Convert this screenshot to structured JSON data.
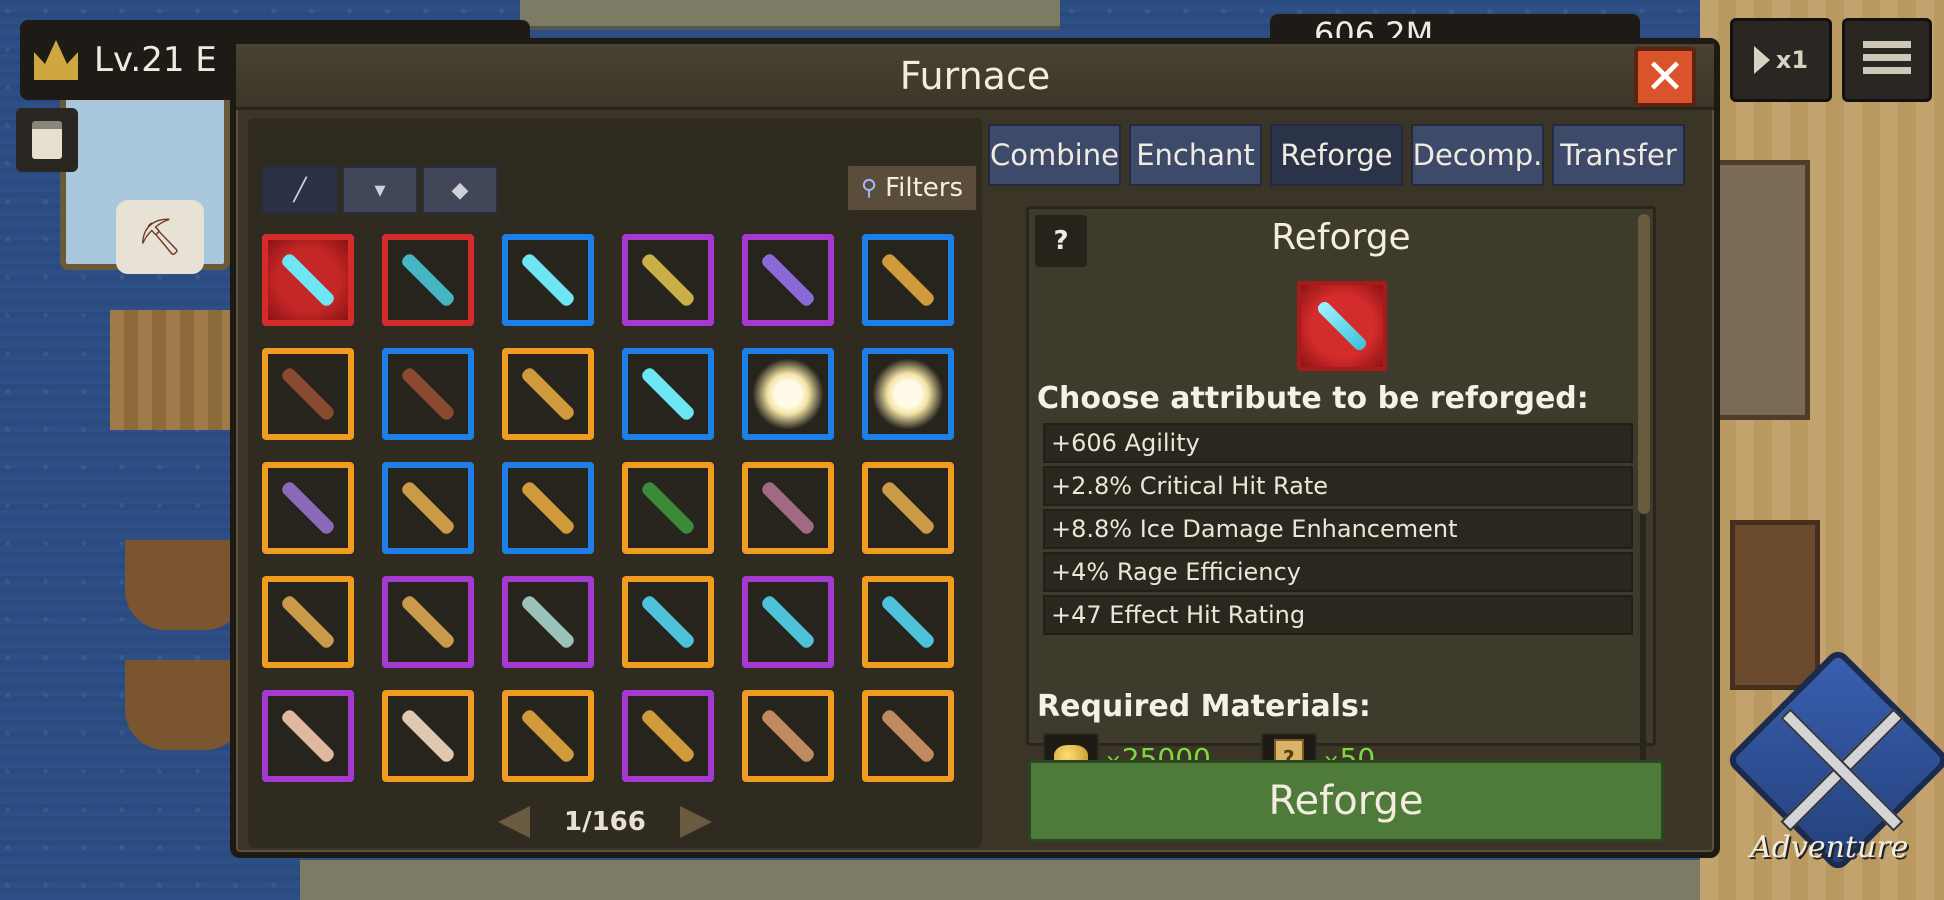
{
  "hud": {
    "level": "Lv.21 E",
    "currency": "606.2M",
    "speed": "x1"
  },
  "adventure": {
    "label": "Adventure"
  },
  "dialog": {
    "title": "Furnace",
    "close": "✕"
  },
  "left": {
    "filters_label": "Filters",
    "page": "1/166",
    "items": [
      {
        "frame": "red",
        "glow": true,
        "weapon": "#6ee5f2"
      },
      {
        "frame": "red",
        "glow": false,
        "weapon": "#46b6c4"
      },
      {
        "frame": "blue",
        "glow": false,
        "weapon": "#6ee5f2"
      },
      {
        "frame": "purple",
        "glow": false,
        "weapon": "#c8b046"
      },
      {
        "frame": "purple",
        "glow": false,
        "weapon": "#8a6ad8"
      },
      {
        "frame": "blue",
        "glow": false,
        "weapon": "#d09a3a"
      },
      {
        "frame": "orange",
        "glow": false,
        "weapon": "#8a4a30"
      },
      {
        "frame": "blue",
        "glow": false,
        "weapon": "#8a4a30"
      },
      {
        "frame": "orange",
        "glow": false,
        "weapon": "#d09a3a"
      },
      {
        "frame": "blue",
        "glow": false,
        "weapon": "#6ee5f2"
      },
      {
        "frame": "blue",
        "glow": false,
        "weapon": "burst"
      },
      {
        "frame": "blue",
        "glow": false,
        "weapon": "burst"
      },
      {
        "frame": "orange",
        "glow": false,
        "weapon": "#8a6ab8"
      },
      {
        "frame": "blue",
        "glow": false,
        "weapon": "#c89a4a"
      },
      {
        "frame": "blue",
        "glow": false,
        "weapon": "#d09a3a"
      },
      {
        "frame": "orange",
        "glow": false,
        "weapon": "#3a8a3a"
      },
      {
        "frame": "orange",
        "glow": false,
        "weapon": "#a06a80"
      },
      {
        "frame": "orange",
        "glow": false,
        "weapon": "#c89a4a"
      },
      {
        "frame": "orange",
        "glow": false,
        "weapon": "#c89a4a"
      },
      {
        "frame": "purple",
        "glow": false,
        "weapon": "#c89a4a"
      },
      {
        "frame": "purple",
        "glow": false,
        "weapon": "#9ac2b8"
      },
      {
        "frame": "orange",
        "glow": false,
        "weapon": "#4ec2d8"
      },
      {
        "frame": "purple",
        "glow": false,
        "weapon": "#4ec2d8"
      },
      {
        "frame": "orange",
        "glow": false,
        "weapon": "#4ec2d8"
      },
      {
        "frame": "purple",
        "glow": false,
        "weapon": "#e0b8a0"
      },
      {
        "frame": "orange",
        "glow": false,
        "weapon": "#e0c8b0"
      },
      {
        "frame": "orange",
        "glow": false,
        "weapon": "#d09a3a"
      },
      {
        "frame": "purple",
        "glow": false,
        "weapon": "#d09a3a"
      },
      {
        "frame": "orange",
        "glow": false,
        "weapon": "#c08a60"
      },
      {
        "frame": "orange",
        "glow": false,
        "weapon": "#c08a60"
      }
    ]
  },
  "tabs": [
    "Combine",
    "Enchant",
    "Reforge",
    "Decomp.",
    "Transfer"
  ],
  "active_tab": "Reforge",
  "reforge": {
    "help": "?",
    "title": "Reforge",
    "choose_label": "Choose attribute to be reforged:",
    "attributes": [
      "+606 Agility",
      "+2.8% Critical Hit Rate",
      "+8.8% Ice Damage Enhancement",
      "+4% Rage Efficiency",
      "+47 Effect Hit Rating"
    ],
    "materials_label": "Required Materials:",
    "materials": [
      {
        "icon": "gold-pile-icon",
        "prefix": "×",
        "qty": "25000"
      },
      {
        "icon": "reforge-scroll-icon",
        "prefix": "×",
        "qty": "50"
      }
    ],
    "button": "Reforge"
  }
}
